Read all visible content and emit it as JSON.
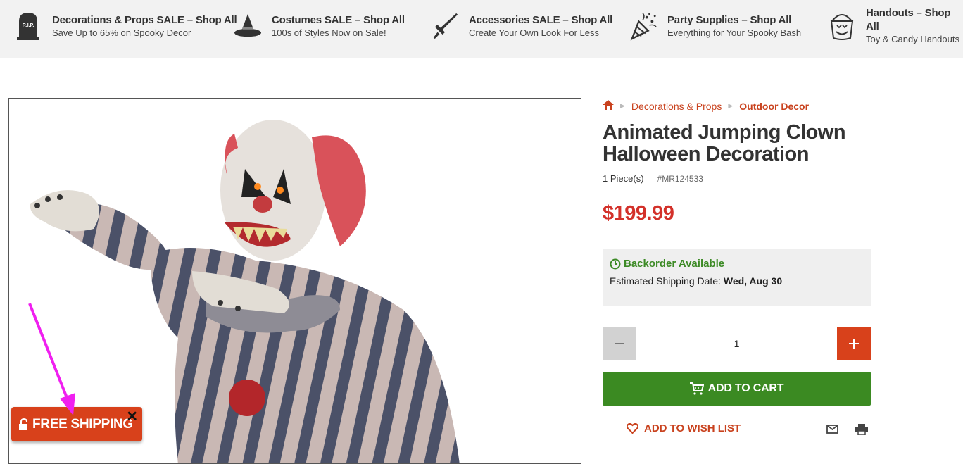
{
  "promos": [
    {
      "title": "Decorations & Props SALE – Shop All",
      "subtitle": "Save Up to 65% on Spooky Decor",
      "icon": "tombstone-icon",
      "icon_text": "R.I.P."
    },
    {
      "title": "Costumes SALE – Shop All",
      "subtitle": "100s of Styles Now on Sale!",
      "icon": "witch-hat-icon"
    },
    {
      "title": "Accessories SALE – Shop All",
      "subtitle": "Create Your Own Look For Less",
      "icon": "sword-icon"
    },
    {
      "title": "Party Supplies – Shop All",
      "subtitle": "Everything for Your Spooky Bash",
      "icon": "party-popper-icon"
    },
    {
      "title": "Handouts – Shop All",
      "subtitle": "Toy & Candy Handouts",
      "icon": "candy-bucket-icon"
    }
  ],
  "breadcrumb": {
    "home_icon": "home-icon",
    "items": [
      "Decorations & Props",
      "Outdoor Decor"
    ]
  },
  "product": {
    "title": "Animated Jumping Clown Halloween Decoration",
    "quantity_label": "1 Piece(s)",
    "sku": "#MR124533",
    "price": "$199.99",
    "stock_status": "Backorder Available",
    "ship_label": "Estimated Shipping Date:",
    "ship_date": "Wed, Aug 30",
    "quantity": "1",
    "add_to_cart": "ADD TO CART",
    "wish_list": "ADD TO WISH LIST"
  },
  "free_shipping": {
    "label": "FREE SHIPPING",
    "close": "✕"
  },
  "colors": {
    "accent": "#d8411b",
    "price": "#d3312a",
    "success": "#3b8a22",
    "annotation_arrow": "#f01ff0"
  }
}
